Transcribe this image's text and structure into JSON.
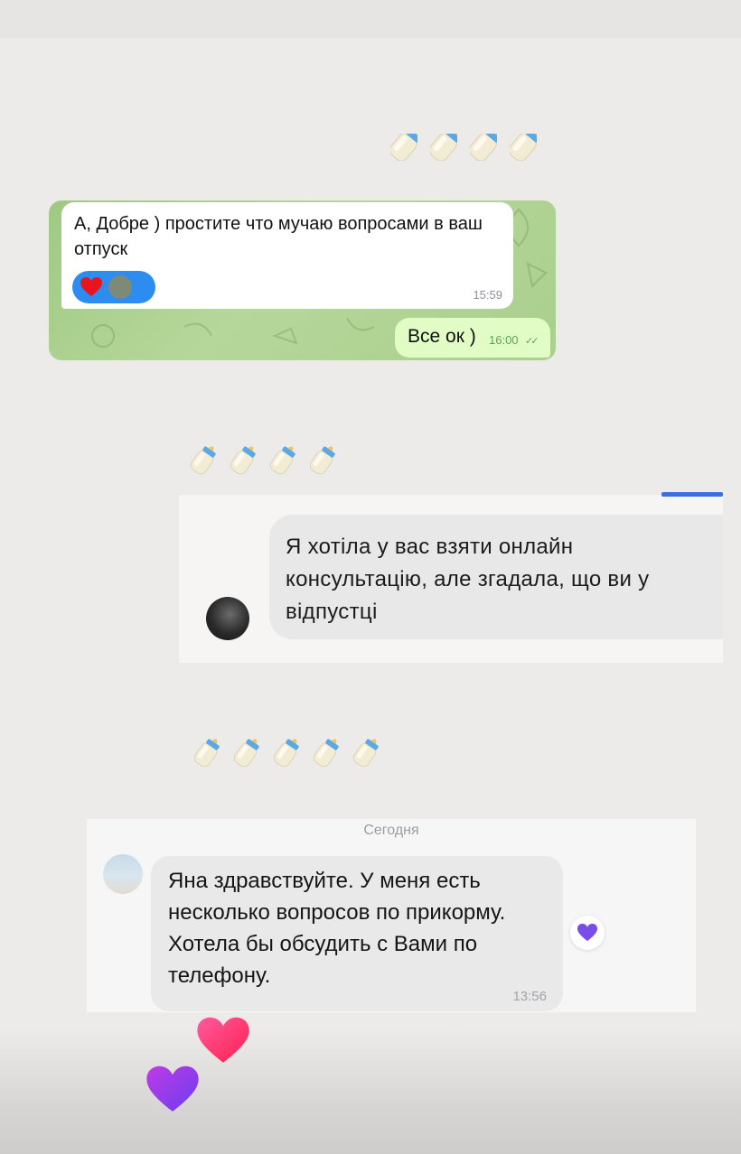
{
  "telegram": {
    "incoming_message": "А, Добре ) простите что мучаю вопросами в ваш отпуск",
    "incoming_time": "15:59",
    "reaction_icon": "heart-icon",
    "outgoing_message": "Все ок )",
    "outgoing_time": "16:00",
    "read_status": "double-check-icon"
  },
  "separator_icon": "baby-bottle-icon",
  "instagram": {
    "message": "Я хотіла у вас взяти онлайн консультацію, але згадала, що ви у відпустці"
  },
  "vk": {
    "date_label": "Сегодня",
    "message": "Яна здравствуйте. У меня есть несколько вопросов по прикорму. Хотела бы обсудить с Вами по телефону.",
    "time": "13:56",
    "reaction_icon": "purple-heart-icon"
  },
  "colors": {
    "telegram_wallpaper": "#a9cf8d",
    "telegram_outgoing": "#e1fdc5",
    "reaction_blue": "#2d8cf0",
    "instagram_bar": "#3c6ee0",
    "heart_pink": "#ff2d7a",
    "heart_purple": "#8a3ff0"
  }
}
